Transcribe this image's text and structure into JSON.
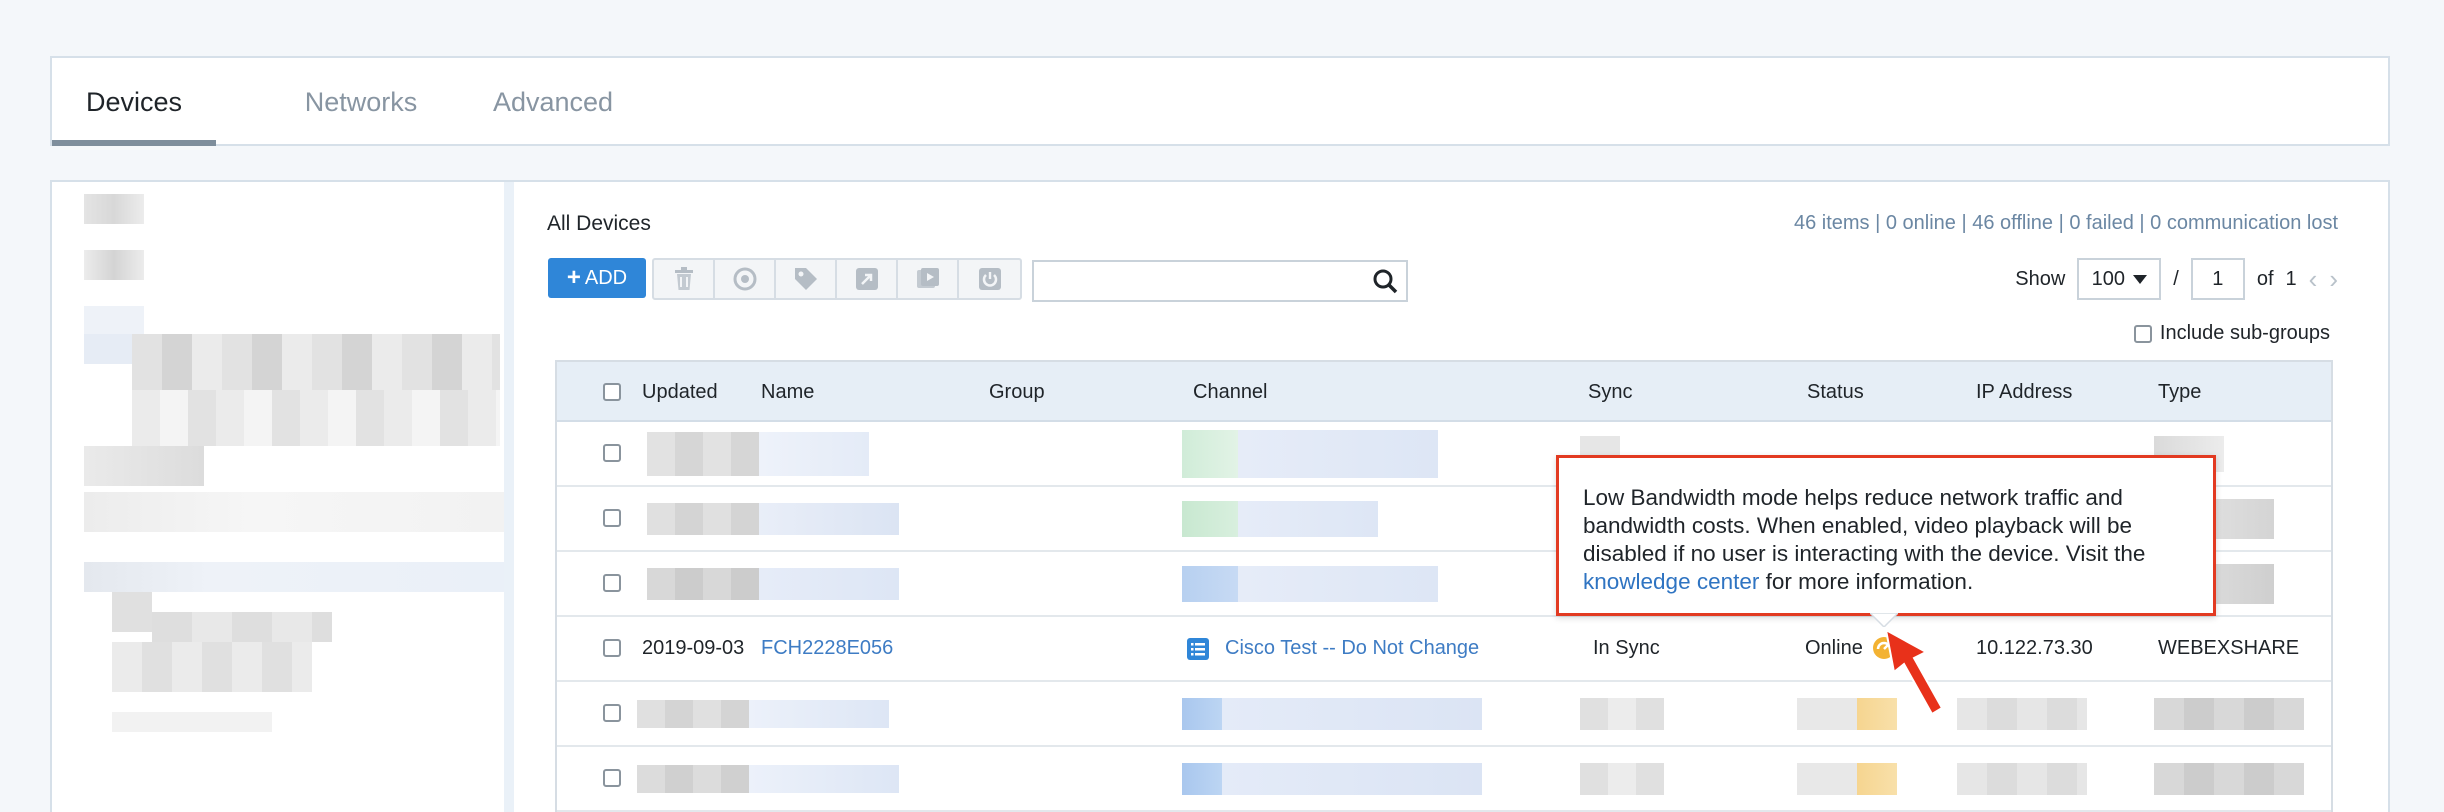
{
  "tabs": [
    {
      "label": "Devices",
      "active": true
    },
    {
      "label": "Networks",
      "active": false
    },
    {
      "label": "Advanced",
      "active": false
    }
  ],
  "section_title": "All Devices",
  "summary": "46 items | 0 online | 46 offline | 0 failed | 0 communication lost",
  "toolbar": {
    "add_label": "ADD",
    "icons": [
      "delete-icon",
      "sync-icon",
      "tag-icon",
      "export-icon",
      "media-icon",
      "power-icon"
    ],
    "search_placeholder": ""
  },
  "pager": {
    "show_label": "Show",
    "page_size": "100",
    "separator": "/",
    "current_page": "1",
    "of_label": "of",
    "total_pages": "1"
  },
  "include_subgroups_label": "Include sub-groups",
  "table": {
    "columns": [
      "Updated",
      "Name",
      "Group",
      "Channel",
      "Sync",
      "Status",
      "IP Address",
      "Type"
    ],
    "visible_row": {
      "updated": "2019-09-03",
      "name": "FCH2228E056",
      "group": "",
      "channel": "Cisco Test -- Do Not Change",
      "sync": "In Sync",
      "status": "Online",
      "ip": "10.122.73.30",
      "type": "WEBEXSHARE"
    }
  },
  "tooltip": {
    "text_before": "Low Bandwidth mode helps reduce network traffic and bandwidth costs. When enabled, video playback will be disabled if no user is interacting with the device. Visit the ",
    "link_text": "knowledge center",
    "text_after": " for more information."
  },
  "colors": {
    "accent": "#2f86d8",
    "link": "#3e7cc4",
    "tooltip_border": "#e23a21",
    "annotation_arrow": "#e8311a"
  }
}
